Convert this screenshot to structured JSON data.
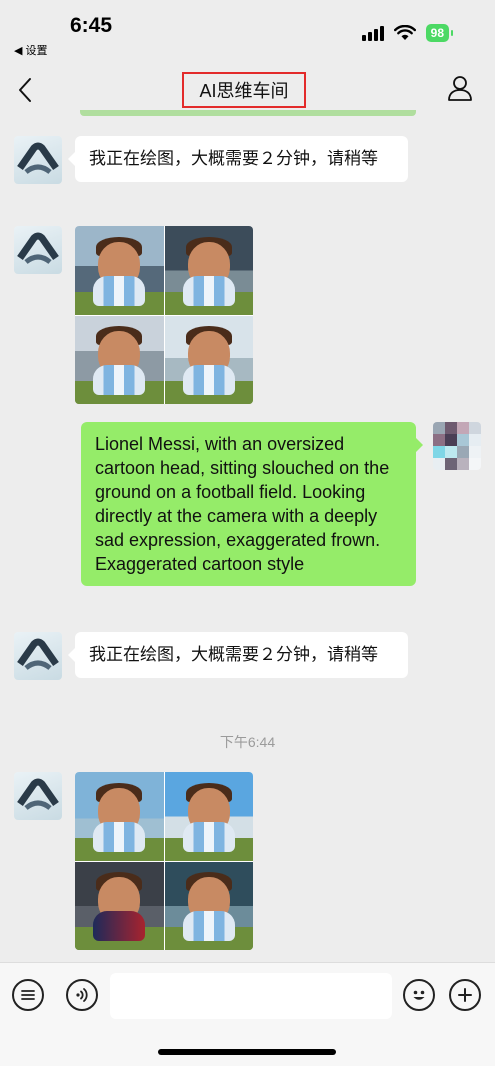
{
  "status_bar": {
    "time": "6:45",
    "back_app": "◀ 设置",
    "battery": "98"
  },
  "nav": {
    "back_icon": "chevron-left-icon",
    "title": "AI思维车间",
    "profile_icon": "person-icon"
  },
  "messages": [
    {
      "from": "bot",
      "type": "text",
      "text": "我正在绘图，大概需要２分钟，请稍等"
    },
    {
      "from": "bot",
      "type": "image",
      "description_icon": "image-grid-icon"
    },
    {
      "from": "user",
      "type": "text",
      "text": "Lionel Messi, with an oversized cartoon head, sitting slouched on the ground on a football field. Looking directly at the camera with a deeply sad expression, exaggerated frown. Exaggerated cartoon style"
    },
    {
      "from": "bot",
      "type": "text",
      "text": "我正在绘图，大概需要２分钟，请稍等"
    },
    {
      "from": "system",
      "type": "timestamp",
      "text": "下午6:44"
    },
    {
      "from": "bot",
      "type": "image",
      "description_icon": "image-grid-icon"
    }
  ],
  "input_bar": {
    "menu_icon": "list-menu-icon",
    "voice_icon": "voice-icon",
    "emoji_icon": "emoji-icon",
    "add_icon": "plus-icon",
    "placeholder": ""
  },
  "colors": {
    "chat_bg": "#ededed",
    "user_bubble": "#95ec69",
    "bot_bubble": "#ffffff",
    "highlight_box": "#e32b2b"
  }
}
